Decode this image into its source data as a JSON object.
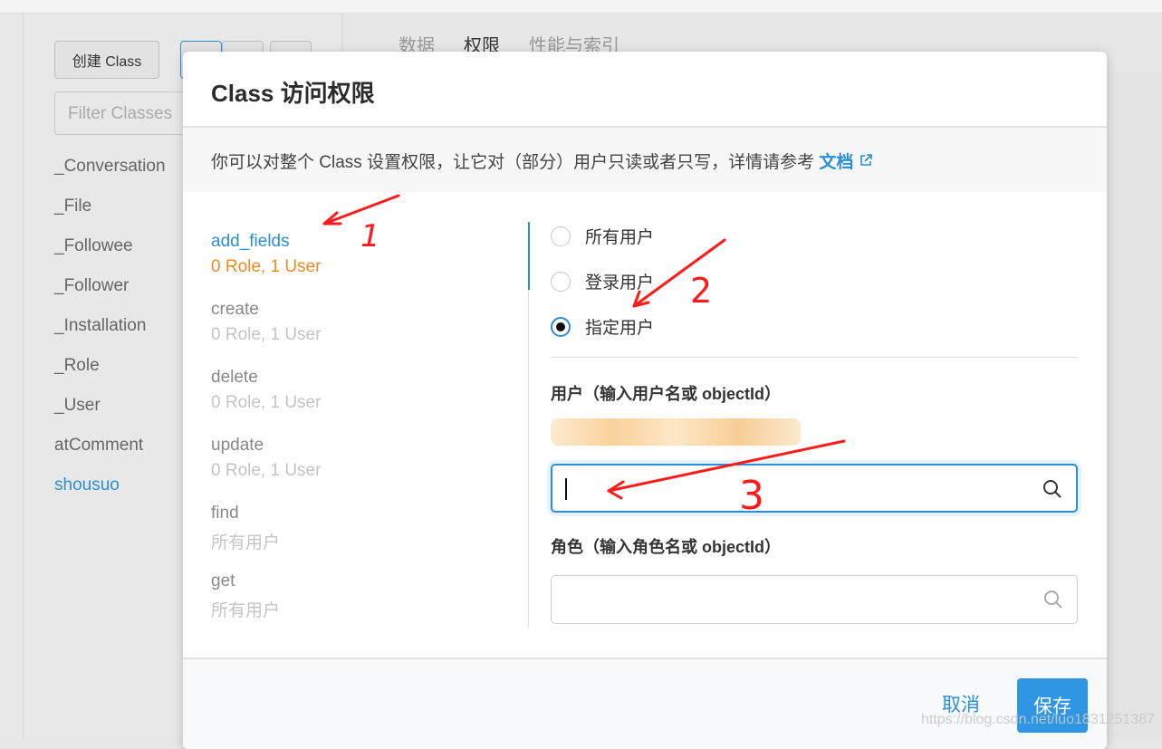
{
  "sidebar": {
    "create_label": "创建 Class",
    "filter_placeholder": "Filter Classes",
    "classes": [
      "_Conversation",
      "_File",
      "_Followee",
      "_Follower",
      "_Installation",
      "_Role",
      "_User",
      "atComment",
      "shousuo"
    ],
    "active": "shousuo"
  },
  "tabs": [
    "数据",
    "权限",
    "性能与索引"
  ],
  "active_tab": "权限",
  "modal": {
    "title": "Class 访问权限",
    "desc": "你可以对整个 Class 设置权限，让它对（部分）用户只读或者只写，详情请参考 ",
    "doc_link": "文档",
    "perms": [
      {
        "name": "add_fields",
        "summary": "0 Role, 1 User"
      },
      {
        "name": "create",
        "summary": "0 Role, 1 User"
      },
      {
        "name": "delete",
        "summary": "0 Role, 1 User"
      },
      {
        "name": "update",
        "summary": "0 Role, 1 User"
      },
      {
        "name": "find",
        "summary": "所有用户"
      },
      {
        "name": "get",
        "summary": "所有用户"
      }
    ],
    "options": [
      "所有用户",
      "登录用户",
      "指定用户"
    ],
    "selected_option": "指定用户",
    "user_label": "用户（输入用户名或 objectId）",
    "role_label": "角色（输入角色名或 objectId）",
    "user_input": "",
    "role_input": "",
    "cancel": "取消",
    "save": "保存"
  },
  "annotations": [
    "1",
    "2",
    "3"
  ],
  "watermark": "https://blog.csdn.net/luo1831251387",
  "colors": {
    "accent": "#2b8fd6",
    "warning": "#f08a24",
    "annotation": "#ff0000"
  }
}
